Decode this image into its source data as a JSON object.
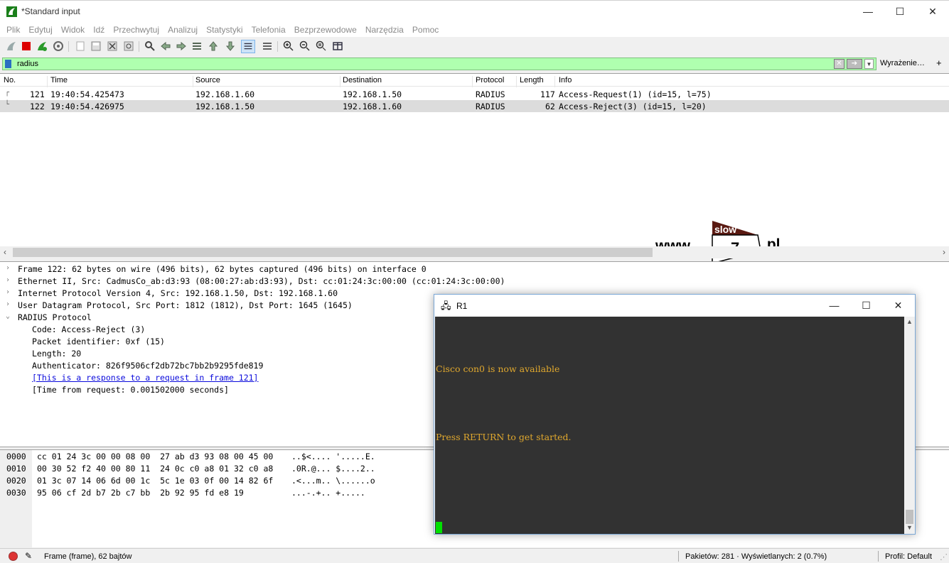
{
  "window": {
    "title": "*Standard input",
    "minimize": "—",
    "maximize": "☐",
    "close": "✕"
  },
  "menu": [
    "Plik",
    "Edytuj",
    "Widok",
    "Idź",
    "Przechwytuj",
    "Analizuj",
    "Statystyki",
    "Telefonia",
    "Bezprzewodowe",
    "Narzędzia",
    "Pomoc"
  ],
  "filter": {
    "value": "radius",
    "expression_button": "Wyrażenie…",
    "add_button": "+"
  },
  "packet_list": {
    "columns": {
      "no": "No.",
      "time": "Time",
      "source": "Source",
      "destination": "Destination",
      "protocol": "Protocol",
      "length": "Length",
      "info": "Info"
    },
    "rows": [
      {
        "no": "121",
        "time": "19:40:54.425473",
        "source": "192.168.1.60",
        "destination": "192.168.1.50",
        "protocol": "RADIUS",
        "length": "117",
        "info": "Access-Request(1) (id=15, l=75)"
      },
      {
        "no": "122",
        "time": "19:40:54.426975",
        "source": "192.168.1.50",
        "destination": "192.168.1.60",
        "protocol": "RADIUS",
        "length": "62",
        "info": "Access-Reject(3) (id=15, l=20)"
      }
    ]
  },
  "logo": {
    "www": "www.",
    "top_word": "slow",
    "number": "7",
    "tld": ".pl"
  },
  "details": {
    "frame": "Frame 122: 62 bytes on wire (496 bits), 62 bytes captured (496 bits) on interface 0",
    "ethernet": "Ethernet II, Src: CadmusCo_ab:d3:93 (08:00:27:ab:d3:93), Dst: cc:01:24:3c:00:00 (cc:01:24:3c:00:00)",
    "ip": "Internet Protocol Version 4, Src: 192.168.1.50, Dst: 192.168.1.60",
    "udp": "User Datagram Protocol, Src Port: 1812 (1812), Dst Port: 1645 (1645)",
    "radius": "RADIUS Protocol",
    "code": "Code: Access-Reject (3)",
    "identifier": "Packet identifier: 0xf (15)",
    "length": "Length: 20",
    "authenticator": "Authenticator: 826f9506cf2db72bc7bb2b9295fde819",
    "response_link": "[This is a response to a request in frame 121]",
    "time_from_request": "[Time from request: 0.001502000 seconds]"
  },
  "bytes": [
    {
      "offset": "0000",
      "hex": "cc 01 24 3c 00 00 08 00  27 ab d3 93 08 00 45 00",
      "ascii": "..$<.... '.....E."
    },
    {
      "offset": "0010",
      "hex": "00 30 52 f2 40 00 80 11  24 0c c0 a8 01 32 c0 a8",
      "ascii": ".0R.@... $....2.."
    },
    {
      "offset": "0020",
      "hex": "01 3c 07 14 06 6d 00 1c  5c 1e 03 0f 00 14 82 6f",
      "ascii": ".<...m.. \\......o"
    },
    {
      "offset": "0030",
      "hex": "95 06 cf 2d b7 2b c7 bb  2b 92 95 fd e8 19",
      "ascii": "...-.+.. +....."
    }
  ],
  "status": {
    "frame": "Frame (frame), 62 bajtów",
    "packets": "Pakietów: 281 · Wyświetlanych: 2 (0.7%)",
    "profile": "Profil: Default"
  },
  "terminal": {
    "title": "R1",
    "line1": "Cisco con0 is now available",
    "line2": "Press RETURN to get started.",
    "minimize": "—",
    "maximize": "☐",
    "close": "✕"
  },
  "colors": {
    "filter_ok": "#afffaf",
    "terminal_bg": "#323232",
    "terminal_text": "#e0a82e",
    "cursor": "#00e000"
  }
}
